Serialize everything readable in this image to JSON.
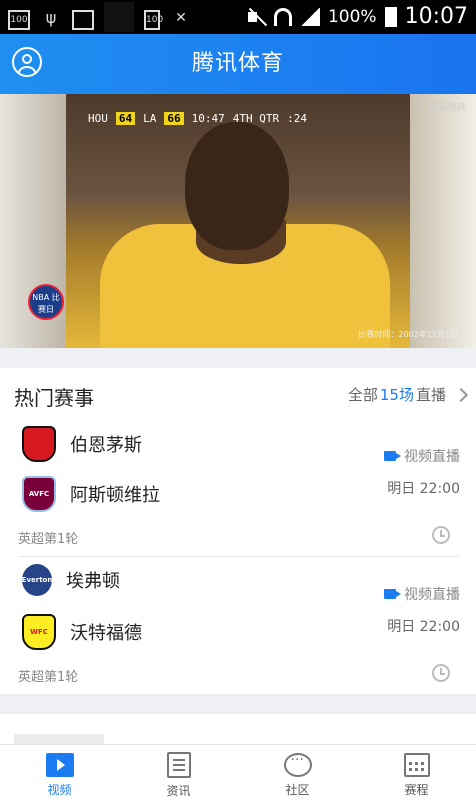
{
  "status_bar": {
    "left_icons": [
      "100",
      "usb-icon",
      "image-icon",
      "blank",
      "battery-saver-icon",
      "no-sim-icon"
    ],
    "battery_badge": "100",
    "battery_percent": "100%",
    "time": "10:07"
  },
  "header": {
    "title": "腾讯体育"
  },
  "video": {
    "scoreboard": {
      "home": "HOU",
      "home_score": "64",
      "away": "LA",
      "away_score": "66",
      "clock": "10:47",
      "quarter": "4TH QTR",
      "shot_clock": ":24"
    },
    "watermark": "腾讯视频",
    "caption": "比赛时间：2002年11月1日",
    "logo_text": "NBA 比赛日"
  },
  "hot_matches": {
    "title": "热门赛事",
    "more_prefix": "全部",
    "more_count": "15场",
    "more_suffix": "直播",
    "matches": [
      {
        "home": "伯恩茅斯",
        "away": "阿斯顿维拉",
        "live_label": "视频直播",
        "time": "明日 22:00",
        "round": "英超第1轮"
      },
      {
        "home": "埃弗顿",
        "away": "沃特福德",
        "live_label": "视频直播",
        "time": "明日 22:00",
        "round": "英超第1轮"
      }
    ]
  },
  "tabbar": {
    "items": [
      {
        "label": "视频",
        "icon": "video-icon",
        "active": true
      },
      {
        "label": "资讯",
        "icon": "news-icon",
        "active": false
      },
      {
        "label": "社区",
        "icon": "community-icon",
        "active": false
      },
      {
        "label": "赛程",
        "icon": "schedule-icon",
        "active": false
      }
    ]
  },
  "colors": {
    "accent": "#1a7cf0",
    "header_start": "#1f8ff0",
    "header_end": "#1a74f0"
  }
}
